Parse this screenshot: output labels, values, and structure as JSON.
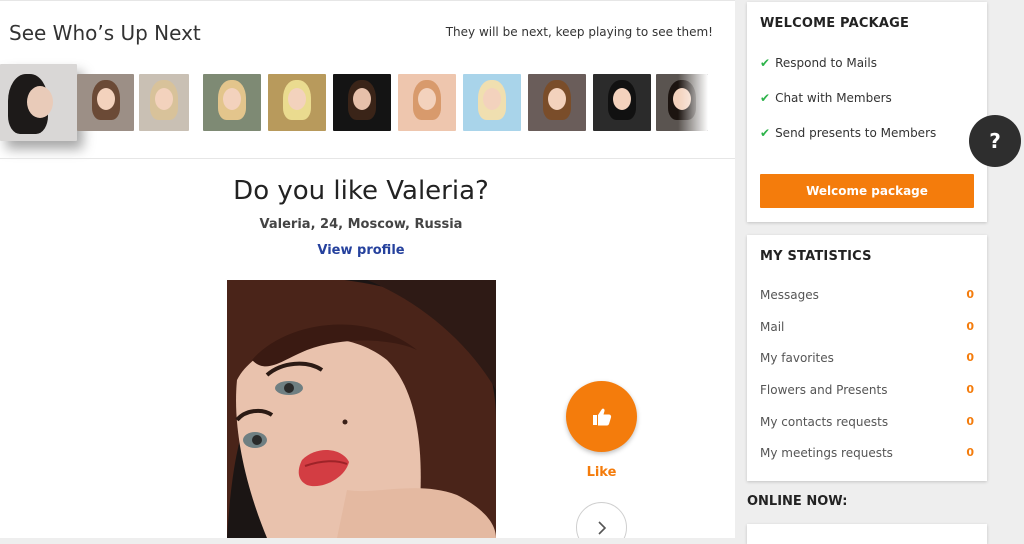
{
  "up_next": {
    "title": "See Who’s Up Next",
    "hint": "They will be next, keep playing to see them!",
    "thumbnails": [
      {
        "bg": "#d9d7d6",
        "hair": "#1d1a19",
        "left": 0
      },
      {
        "bg": "#9c8f86",
        "hair": "#6b4a36"
      },
      {
        "bg": "#c9c0b4",
        "hair": "#d8c29a"
      },
      {
        "bg": "#7e8a74",
        "hair": "#e3c58c"
      },
      {
        "bg": "#b89a5c",
        "hair": "#eadb8f"
      },
      {
        "bg": "#141414",
        "hair": "#3a2418"
      },
      {
        "bg": "#eec6ae",
        "hair": "#d89a6c"
      },
      {
        "bg": "#a9d4ea",
        "hair": "#f0dfb0"
      },
      {
        "bg": "#6a5d5a",
        "hair": "#7a4d2a"
      },
      {
        "bg": "#2b2b2b",
        "hair": "#111111"
      },
      {
        "bg": "#5a5450",
        "hair": "#1c1410"
      }
    ]
  },
  "profile": {
    "question": "Do you like Valeria?",
    "details": "Valeria, 24, Moscow, Russia",
    "view_profile": "View profile"
  },
  "actions": {
    "like_label": "Like",
    "like_icon": "thumbs-up-icon",
    "next_icon": "chevron-right-icon"
  },
  "welcome": {
    "title": "WELCOME PACKAGE",
    "items": [
      "Respond to Mails",
      "Chat with Members",
      "Send presents to Members"
    ],
    "button": "Welcome package"
  },
  "stats": {
    "title": "MY STATISTICS",
    "rows": [
      {
        "label": "Messages",
        "value": "0"
      },
      {
        "label": "Mail",
        "value": "0"
      },
      {
        "label": "My favorites",
        "value": "0"
      },
      {
        "label": "Flowers and Presents",
        "value": "0"
      },
      {
        "label": "My contacts requests",
        "value": "0"
      },
      {
        "label": "My meetings requests",
        "value": "0"
      }
    ]
  },
  "online_now": "ONLINE NOW:",
  "help_label": "?",
  "colors": {
    "accent": "#f47c0c",
    "link": "#25419d",
    "check": "#2db34a"
  }
}
